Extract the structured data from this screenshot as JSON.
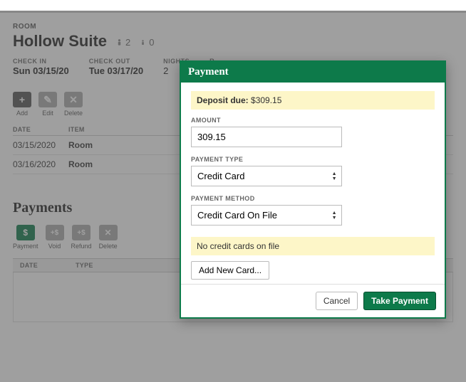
{
  "room": {
    "label": "ROOM",
    "name": "Hollow Suite",
    "adults": "2",
    "children": "0"
  },
  "meta": {
    "checkin_label": "CHECK IN",
    "checkin": "Sun 03/15/20",
    "checkout_label": "CHECK OUT",
    "checkout": "Tue 03/17/20",
    "nights_label": "NIGHTS",
    "nights": "2",
    "extra_label": "R"
  },
  "tools": {
    "add": "Add",
    "edit": "Edit",
    "delete": "Delete"
  },
  "items_table": {
    "head_date": "DATE",
    "head_item": "ITEM",
    "rows": [
      {
        "date": "03/15/2020",
        "item": "Room"
      },
      {
        "date": "03/16/2020",
        "item": "Room"
      }
    ]
  },
  "payments": {
    "heading": "Payments",
    "tools": {
      "payment": "Payment",
      "void": "Void",
      "refund": "Refund",
      "delete": "Delete"
    },
    "head_date": "DATE",
    "head_type": "TYPE"
  },
  "modal": {
    "title": "Payment",
    "deposit_label": "Deposit due:",
    "deposit_value": "$309.15",
    "amount_label": "AMOUNT",
    "amount_value": "309.15",
    "ptype_label": "PAYMENT TYPE",
    "ptype_value": "Credit Card",
    "pmethod_label": "PAYMENT METHOD",
    "pmethod_value": "Credit Card On File",
    "no_cards": "No credit cards on file",
    "add_card": "Add New Card...",
    "cancel": "Cancel",
    "take": "Take Payment"
  }
}
